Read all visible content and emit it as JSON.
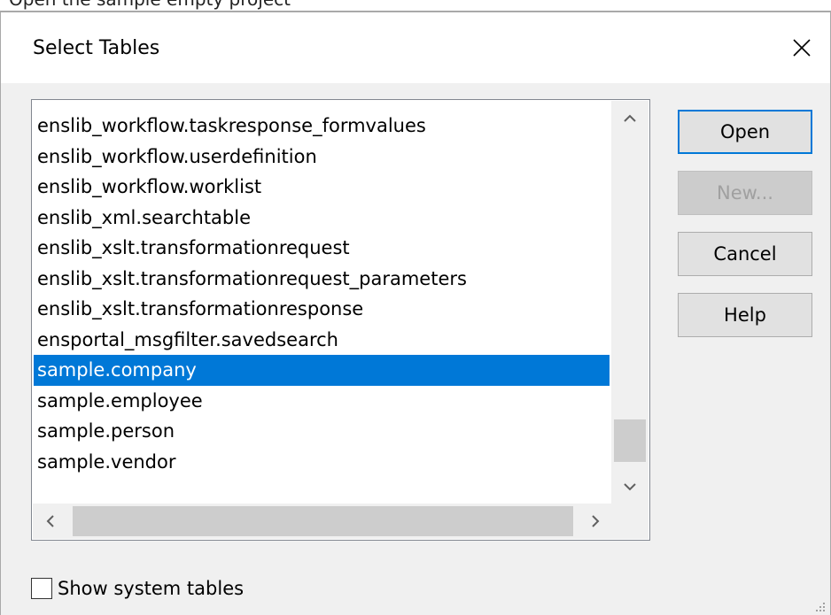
{
  "background_text": "Open the sample empty project",
  "dialog": {
    "title": "Select Tables",
    "close_icon": "close-icon"
  },
  "table_list": {
    "items": [
      "enslib_workflow.taskresponse_formvalues",
      "enslib_workflow.userdefinition",
      "enslib_workflow.worklist",
      "enslib_xml.searchtable",
      "enslib_xslt.transformationrequest",
      "enslib_xslt.transformationrequest_parameters",
      "enslib_xslt.transformationresponse",
      "ensportal_msgfilter.savedsearch",
      "sample.company",
      "sample.employee",
      "sample.person",
      "sample.vendor"
    ],
    "selected": "sample.company",
    "vertical_scrollbar": {
      "up_icon": "chevron-up-icon",
      "down_icon": "chevron-down-icon"
    },
    "horizontal_scrollbar": {
      "left_icon": "chevron-left-icon",
      "right_icon": "chevron-right-icon"
    }
  },
  "buttons": {
    "open": "Open",
    "new": "New...",
    "cancel": "Cancel",
    "help": "Help"
  },
  "show_system_tables": {
    "label": "Show system tables",
    "checked": false
  },
  "colors": {
    "selection": "#0078d7",
    "default_button_border": "#0078d7",
    "dialog_background": "#f0f0f0"
  }
}
